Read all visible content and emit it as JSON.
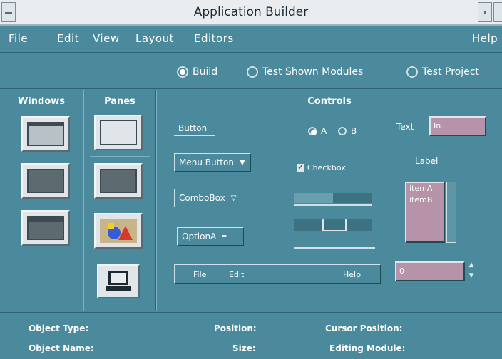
{
  "window": {
    "title": "Application Builder"
  },
  "menu": {
    "items": [
      "File",
      "Edit",
      "View",
      "Layout",
      "Editors"
    ],
    "help": "Help"
  },
  "mode": {
    "options": [
      "Build",
      "Test Shown Modules",
      "Test Project"
    ],
    "selected": "Build"
  },
  "palette": {
    "windows_title": "Windows",
    "panes_title": "Panes",
    "controls_title": "Controls",
    "icons": [
      "main-window-icon",
      "custom-dialog-icon",
      "file-chooser-icon",
      "control-pane-icon",
      "text-pane-icon",
      "drawing-area-icon",
      "term-pane-icon"
    ]
  },
  "controls": {
    "button_label": "Button",
    "menu_button_label": "Menu Button",
    "combo_box_label": "ComboBox",
    "option_label": "OptionA",
    "radio_a": "A",
    "radio_b": "B",
    "checkbox_label": "Checkbox",
    "checkbox_checked": true,
    "text_label": "Text",
    "text_value": "In",
    "list_label": "Label",
    "list_items": [
      "itemA",
      "itemB"
    ],
    "menubar_items": [
      "File",
      "Edit"
    ],
    "menubar_help": "Help",
    "spinbox_value": "0",
    "gauge_level": 0.5
  },
  "status": {
    "object_type_label": "Object Type:",
    "object_name_label": "Object Name:",
    "position_label": "Position:",
    "size_label": "Size:",
    "cursor_position_label": "Cursor Position:",
    "editing_module_label": "Editing Module:"
  },
  "colors": {
    "background": "#4a8a9c",
    "accent_field": "#b693a8",
    "titlebar": "#e9edf0"
  }
}
